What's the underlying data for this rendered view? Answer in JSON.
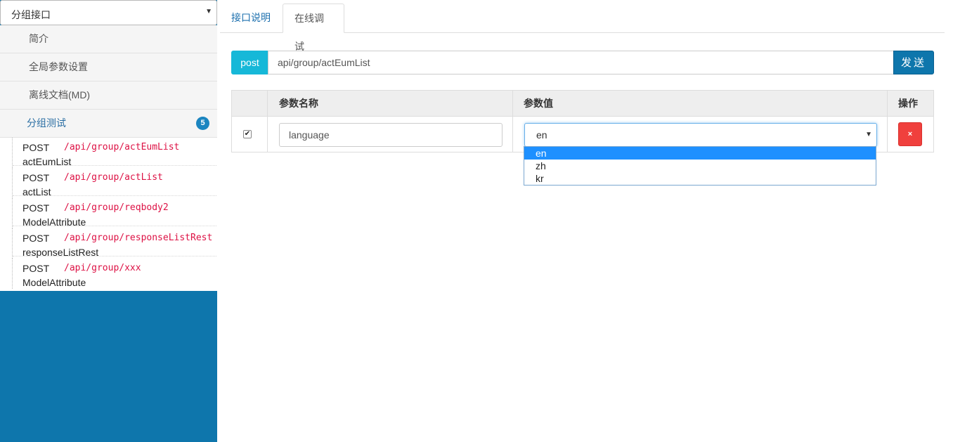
{
  "sidebar": {
    "group_select": "分组接口",
    "menu": [
      {
        "label": "简介"
      },
      {
        "label": "全局参数设置"
      },
      {
        "label": "离线文档(MD)"
      }
    ],
    "group": {
      "label": "分组测试",
      "count": "5"
    },
    "apis": [
      {
        "method": "POST",
        "path": "/api/group/actEumList",
        "name": "actEumList"
      },
      {
        "method": "POST",
        "path": "/api/group/actList",
        "name": "actList"
      },
      {
        "method": "POST",
        "path": "/api/group/reqbody2",
        "name": "ModelAttribute"
      },
      {
        "method": "POST",
        "path": "/api/group/responseListRest",
        "name": "responseListRest"
      },
      {
        "method": "POST",
        "path": "/api/group/xxx",
        "name": "ModelAttribute"
      }
    ]
  },
  "tabs": {
    "doc": "接口说明",
    "debug": "在线调试"
  },
  "request": {
    "method": "post",
    "url": "api/group/actEumList",
    "send": "发送"
  },
  "table": {
    "headers": {
      "name": "参数名称",
      "value": "参数值",
      "action": "操作"
    },
    "row": {
      "checked": "✔",
      "name": "language",
      "value": "en",
      "delete": "×"
    },
    "options": [
      "en",
      "zh",
      "kr"
    ]
  },
  "colors": {
    "primary": "#0e76ac",
    "method": "#16b8d8",
    "danger": "#f0403d",
    "path": "#dd1144"
  }
}
